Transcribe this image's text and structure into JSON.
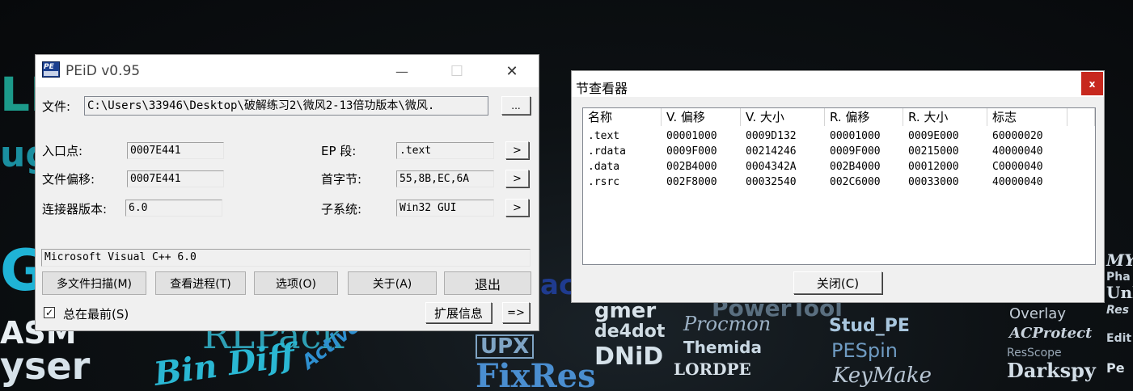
{
  "wallpaper": {
    "words": [
      "gmer",
      "de4dot",
      "DNiD",
      "FixRes",
      "Procmon",
      "Themida",
      "LORDPE",
      "Stud_PE",
      "PESpin",
      "KeyMake",
      "Overlay",
      "ACProtect",
      "ResScope",
      "Darkspy",
      "Bin Diff",
      "ASM",
      "yser",
      "RLPack",
      "Active Delp",
      "UPX",
      "PowerTool"
    ]
  },
  "peid": {
    "title": "PEiD v0.95",
    "minimize_glyph": "—",
    "maximize_glyph": "☐",
    "close_glyph": "✕",
    "file_label": "文件:",
    "file_path": "C:\\Users\\33946\\Desktop\\破解练习2\\微风2-13倍功版本\\微风.",
    "browse_label": "...",
    "entry_label": "入口点:",
    "entry_value": "0007E441",
    "ep_section_label": "EP 段:",
    "ep_section_value": ".text",
    "offset_label": "文件偏移:",
    "offset_value": "0007E441",
    "first_bytes_label": "首字节:",
    "first_bytes_value": "55,8B,EC,6A",
    "linker_label": "连接器版本:",
    "linker_value": "6.0",
    "subsystem_label": "子系统:",
    "subsystem_value": "Win32 GUI",
    "arrow_glyph": ">",
    "detected": "Microsoft Visual C++ 6.0",
    "buttons": {
      "multi_scan": "多文件扫描(M)",
      "task_viewer": "查看进程(T)",
      "options": "选项(O)",
      "about": "关于(A)",
      "exit": "退出",
      "plugins": "扩展信息",
      "more": "=>"
    },
    "always_on_top_label": "总在最前(S)",
    "always_on_top_checked": true,
    "check_glyph": "✓"
  },
  "section_viewer": {
    "title": "节查看器",
    "close_glyph": "x",
    "columns": [
      "名称",
      "V. 偏移",
      "V. 大小",
      "R. 偏移",
      "R. 大小",
      "标志"
    ],
    "rows": [
      [
        ".text",
        "00001000",
        "0009D132",
        "00001000",
        "0009E000",
        "60000020"
      ],
      [
        ".rdata",
        "0009F000",
        "00214246",
        "0009F000",
        "00215000",
        "40000040"
      ],
      [
        ".data",
        "002B4000",
        "0004342A",
        "002B4000",
        "00012000",
        "C0000040"
      ],
      [
        ".rsrc",
        "002F8000",
        "00032540",
        "002C6000",
        "00033000",
        "40000040"
      ]
    ],
    "close_button": "关闭(C)"
  }
}
